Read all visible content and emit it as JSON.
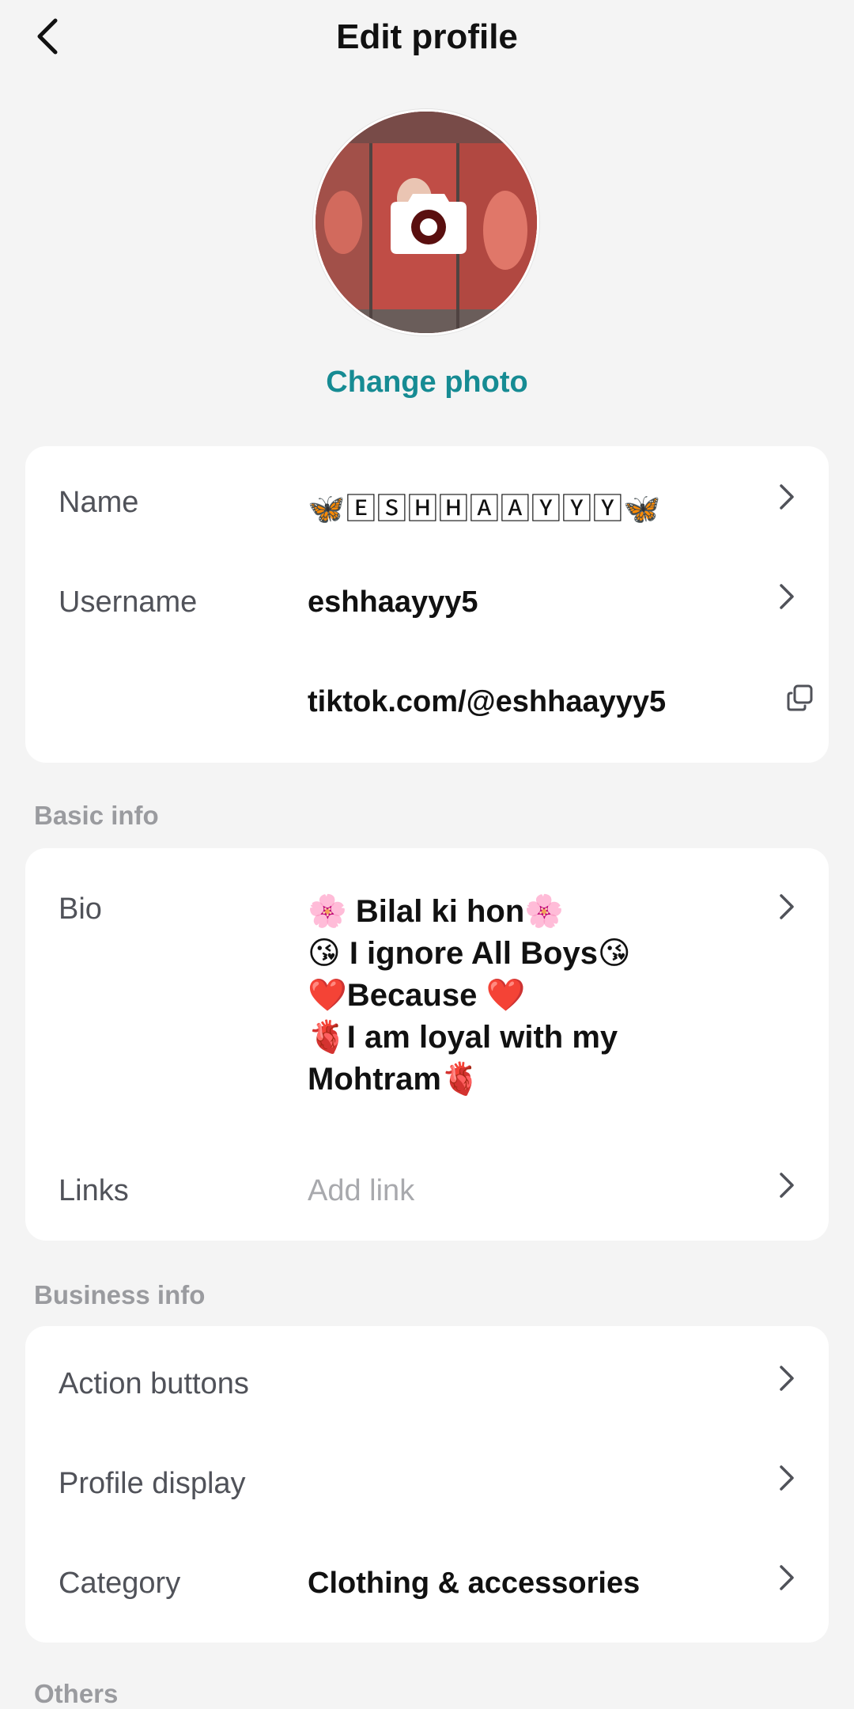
{
  "header": {
    "title": "Edit profile",
    "back_icon": "chevron-left-icon"
  },
  "profile_photo": {
    "change_label": "Change photo",
    "camera_icon": "camera-icon"
  },
  "identity_card": {
    "name": {
      "label": "Name",
      "value": "🦋🄴🅂🄷🄷🄰🄰🅈🅈🅈🦋"
    },
    "username": {
      "label": "Username",
      "value": "eshhaayyy5"
    },
    "profile_link": {
      "value": "tiktok.com/@eshhaayyy5",
      "icon": "copy-icon"
    }
  },
  "basic_info": {
    "section_title": "Basic info",
    "bio": {
      "label": "Bio",
      "lines": [
        "🌸 Bilal ki hon🌸",
        "😘 I ignore All Boys😘",
        "❤️Because ❤️",
        "🫀I am loyal with my",
        "Mohtram🫀"
      ]
    },
    "links": {
      "label": "Links",
      "placeholder": "Add link"
    }
  },
  "business_info": {
    "section_title": "Business info",
    "action_buttons": {
      "label": "Action buttons"
    },
    "profile_display": {
      "label": "Profile display"
    },
    "category": {
      "label": "Category",
      "value": "Clothing & accessories"
    }
  },
  "others": {
    "section_title": "Others"
  },
  "colors": {
    "accent": "#168b93",
    "background": "#f4f4f4",
    "card": "#ffffff"
  }
}
